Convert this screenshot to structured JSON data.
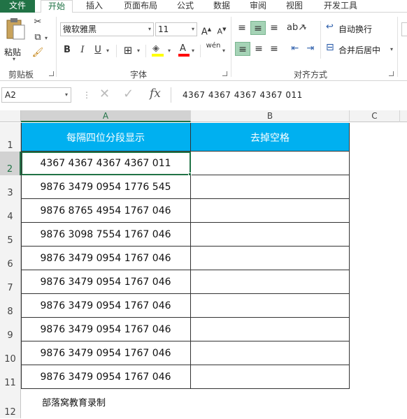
{
  "ribbon_tabs": [
    "文件",
    "开始",
    "插入",
    "页面布局",
    "公式",
    "数据",
    "审阅",
    "视图",
    "开发工具"
  ],
  "clipboard": {
    "paste_label": "粘贴",
    "group_label": "剪贴板"
  },
  "font": {
    "name": "微软雅黑",
    "size": "11",
    "group_label": "字体",
    "bold": "B",
    "italic": "I",
    "underline": "U",
    "phonetic": "wén"
  },
  "alignment": {
    "wrap_text": "自动换行",
    "merge_center": "合并后居中",
    "group_label": "对齐方式"
  },
  "formula_bar": {
    "name_box": "A2",
    "fx": "fx",
    "content": "4367 4367 4367 4367 011"
  },
  "columns": [
    "A",
    "B",
    "C"
  ],
  "rows": [
    "1",
    "2",
    "3",
    "4",
    "5",
    "6",
    "7",
    "8",
    "9",
    "10",
    "11",
    "12"
  ],
  "header": {
    "a": "每隔四位分段显示",
    "b": "去掉空格"
  },
  "values": [
    "4367 4367 4367 4367 011",
    "9876 3479 0954 1776 545",
    "9876 8765 4954 1767 046",
    "9876 3098 7554 1767 046",
    "9876 3479 0954 1767 046",
    "9876 3479 0954 1767 046",
    "9876 3479 0954 1767 046",
    "9876 3479 0954 1767 046",
    "9876 3479 0954 1767 046",
    "9876 3479 0954 1767 046"
  ],
  "footer_note": "部落窝教育录制",
  "colors": {
    "accent": "#217346",
    "header_fill": "#00b0f0"
  }
}
